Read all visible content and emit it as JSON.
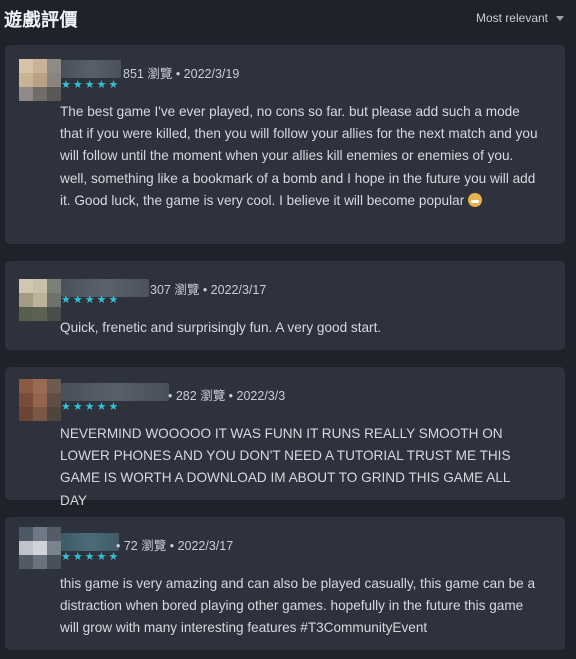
{
  "header": {
    "title": "遊戲評價",
    "sort_label": "Most relevant"
  },
  "reviews": [
    {
      "views": "851 瀏覽",
      "date": "2022/3/19",
      "rating": 5,
      "text": "The best game I've ever played, no cons so far. but please add such a mode that if you were killed, then you will follow your allies for the next match and you will follow until the moment when your allies kill enemies or enemies of you. well, something like a bookmark of a bomb and I hope in the future you will add it. Good luck, the game is very cool. I believe it will become popular"
    },
    {
      "views": "307 瀏覽",
      "date": "2022/3/17",
      "rating": 5,
      "text": "Quick, frenetic and surprisingly fun. A very good start."
    },
    {
      "views": "282 瀏覽",
      "date": "2022/3/3",
      "rating": 5,
      "text": "NEVERMIND WOOOOO IT WAS FUNN IT RUNS REALLY SMOOTH ON LOWER PHONES AND YOU DON'T NEED A TUTORIAL TRUST ME THIS GAME IS WORTH A DOWNLOAD IM ABOUT TO GRIND THIS GAME ALL DAY"
    },
    {
      "views": "72 瀏覽",
      "date": "2022/3/17",
      "rating": 5,
      "text": "this game is very amazing and can also be played casually, this game can be a distraction when bored playing other games. hopefully in the future this game will grow with many interesting features #T3CommunityEvent"
    }
  ],
  "colors": {
    "star": "#2ec4d6",
    "card_bg": "#2d323d",
    "page_bg": "#1e222a"
  }
}
